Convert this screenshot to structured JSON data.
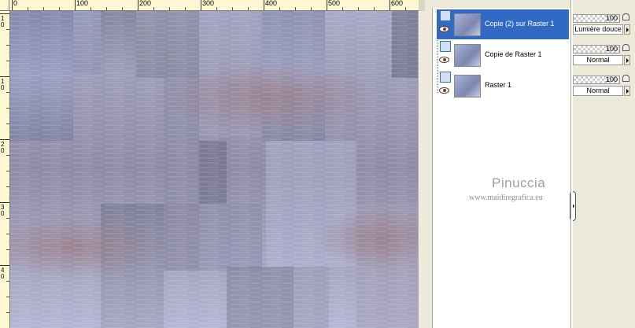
{
  "ruler": {
    "labels": [
      "0",
      "100",
      "200",
      "300",
      "400",
      "500",
      "600"
    ],
    "vertical_labels": [
      "1",
      "0",
      "1",
      "0",
      "2",
      "0",
      "3",
      "0",
      "4",
      "0"
    ]
  },
  "layers": [
    {
      "name": "Copie (2) sur Raster 1",
      "selected": true,
      "opacity": "100",
      "blend": "Lumière douce"
    },
    {
      "name": "Copie de Raster 1",
      "selected": false,
      "opacity": "100",
      "blend": "Normal"
    },
    {
      "name": "Raster 1",
      "selected": false,
      "opacity": "100",
      "blend": "Normal"
    }
  ],
  "watermark": {
    "title": "Pinuccia",
    "url": "www.maidiregrafica.eu"
  },
  "colors": {
    "selection": "#316ac5",
    "panel_bg": "#ece9d8",
    "ruler_bg": "#fdf8d2"
  },
  "icons": {
    "visibility": "layer-visibility-icon",
    "eye": "eye-icon",
    "lock": "lock-icon"
  }
}
